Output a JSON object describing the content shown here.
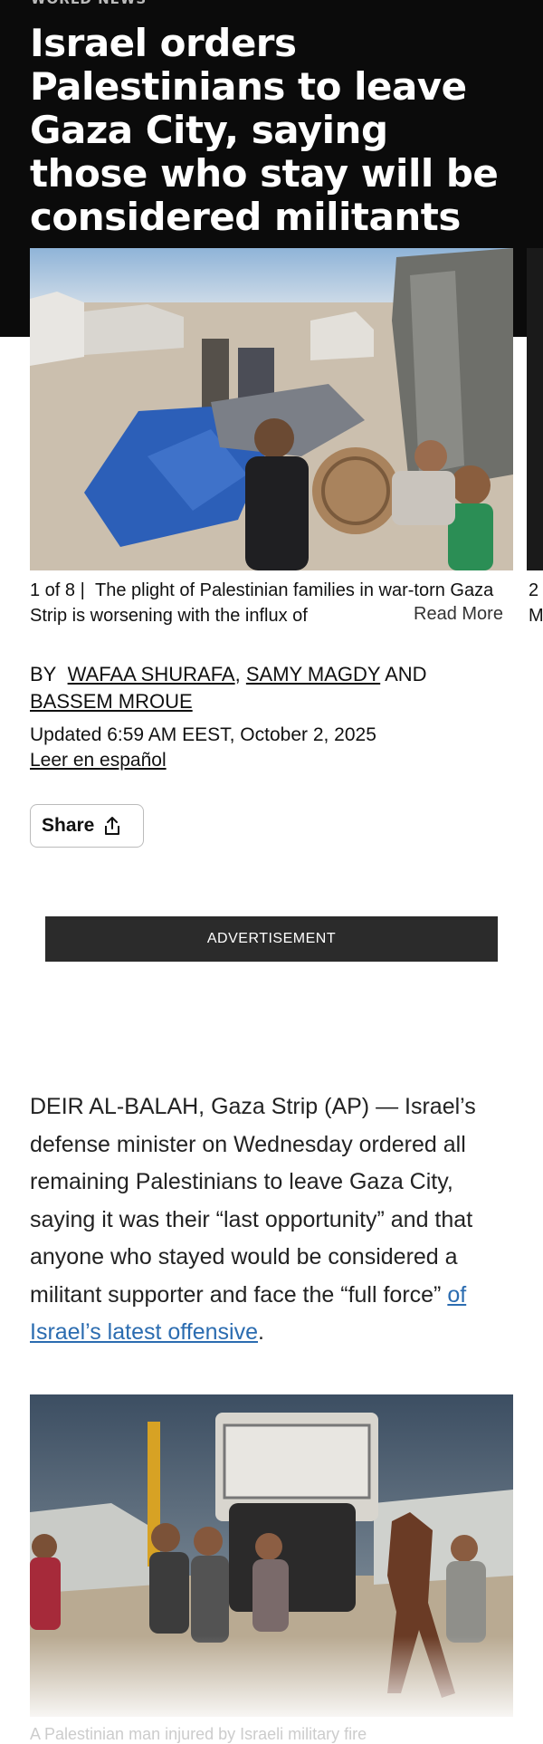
{
  "hero": {
    "section_tag": "WORLD NEWS",
    "headline": "Israel orders Palestinians to leave Gaza City, saying those who stay will be considered militants"
  },
  "carousel": {
    "counter": "1 of 8 |",
    "caption": "The plight of Palestinian families in war-torn Gaza Strip is worsening with the influx of",
    "read_more": "Read More",
    "next_counter": "2",
    "next_caption_start": "M"
  },
  "byline": {
    "prefix": "BY",
    "authors": [
      "WAFAA SHURAFA",
      "SAMY MAGDY",
      "BASSEM MROUE"
    ],
    "sep1": ",",
    "and": "AND"
  },
  "meta": {
    "updated": "Updated 6:59 AM EEST, October 2, 2025",
    "spanish_link": "Leer en español"
  },
  "share": {
    "label": "Share",
    "icon": "share-icon"
  },
  "advertisement": {
    "label": "ADVERTISEMENT"
  },
  "article": {
    "lead": "DEIR AL-BALAH, Gaza Strip (AP) — Israel’s defense minister on Wednesday ordered all remaining Palestinians to leave Gaza City, saying it was their “last opportunity” and that anyone who stayed would be considered a militant supporter and face the “full force”",
    "link_text": "of Israel’s latest offensive",
    "end": "."
  },
  "photo2": {
    "caption_start": "A Palestinian man injured by Israeli military fire"
  },
  "colors": {
    "hero_bg": "#0b0b0b",
    "link": "#2b6cb0",
    "ad_bg": "#2b2b2b"
  }
}
